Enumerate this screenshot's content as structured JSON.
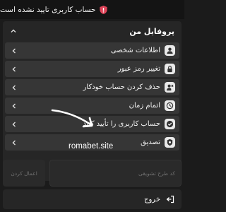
{
  "alert": {
    "text": "حساب کاربری تایید نشده است",
    "icon": "shield-alert-icon",
    "color": "#e0455a"
  },
  "profile": {
    "title": "پروفایل من",
    "items": [
      {
        "label": "اطلاعات شخصی",
        "icon": "user-card-icon"
      },
      {
        "label": "تغییر رمز عبور",
        "icon": "lock-icon"
      },
      {
        "label": "حذف کردن حساب خودکار",
        "icon": "user-remove-icon"
      },
      {
        "label": "اتمام زمان",
        "icon": "clock-icon"
      },
      {
        "label": "حساب کاربری را تأیید کنید",
        "icon": "check-circle-icon"
      },
      {
        "label": "تصدیق",
        "icon": "verify-badge-icon"
      }
    ]
  },
  "watermark": "romabet.site",
  "promo": {
    "placeholder": "کد طرح تشویقی",
    "apply_label": "اعمال کردن"
  },
  "logout": {
    "label": "خروج"
  }
}
